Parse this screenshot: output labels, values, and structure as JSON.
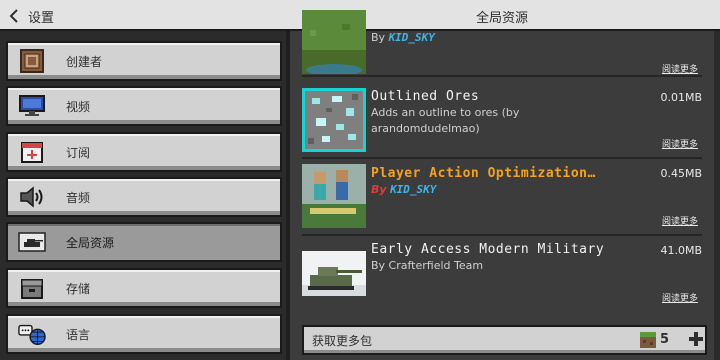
{
  "header": {
    "back_label": "设置",
    "title": "全局资源"
  },
  "sidebar": {
    "items": [
      {
        "label": "创建者",
        "icon": "creator-icon"
      },
      {
        "label": "视频",
        "icon": "monitor-icon"
      },
      {
        "label": "订阅",
        "icon": "subscription-icon"
      },
      {
        "label": "音频",
        "icon": "speaker-icon"
      },
      {
        "label": "全局资源",
        "icon": "tank-icon",
        "active": true
      },
      {
        "label": "存储",
        "icon": "storage-icon"
      },
      {
        "label": "语言",
        "icon": "language-icon"
      }
    ]
  },
  "packs": [
    {
      "author_prefix": "By",
      "author": "KID_SKY",
      "read_more": "阅读更多"
    },
    {
      "name": "Outlined Ores",
      "size": "0.01MB",
      "desc": "Adds an outline to ores (by arandomdudelmao)",
      "read_more": "阅读更多"
    },
    {
      "name": "Player Action Optimization…",
      "size": "0.45MB",
      "author_prefix": "By",
      "author": "KID_SKY",
      "read_more": "阅读更多"
    },
    {
      "name": "Early Access Modern Military",
      "size": "41.0MB",
      "author": "By Crafterfield Team",
      "read_more": "阅读更多"
    }
  ],
  "footer": {
    "more_label": "获取更多包",
    "count": "5"
  },
  "colors": {
    "featured_title": "#f6a21e",
    "author_highlight": "#3fb4e8",
    "by_red": "#e03b3b"
  }
}
